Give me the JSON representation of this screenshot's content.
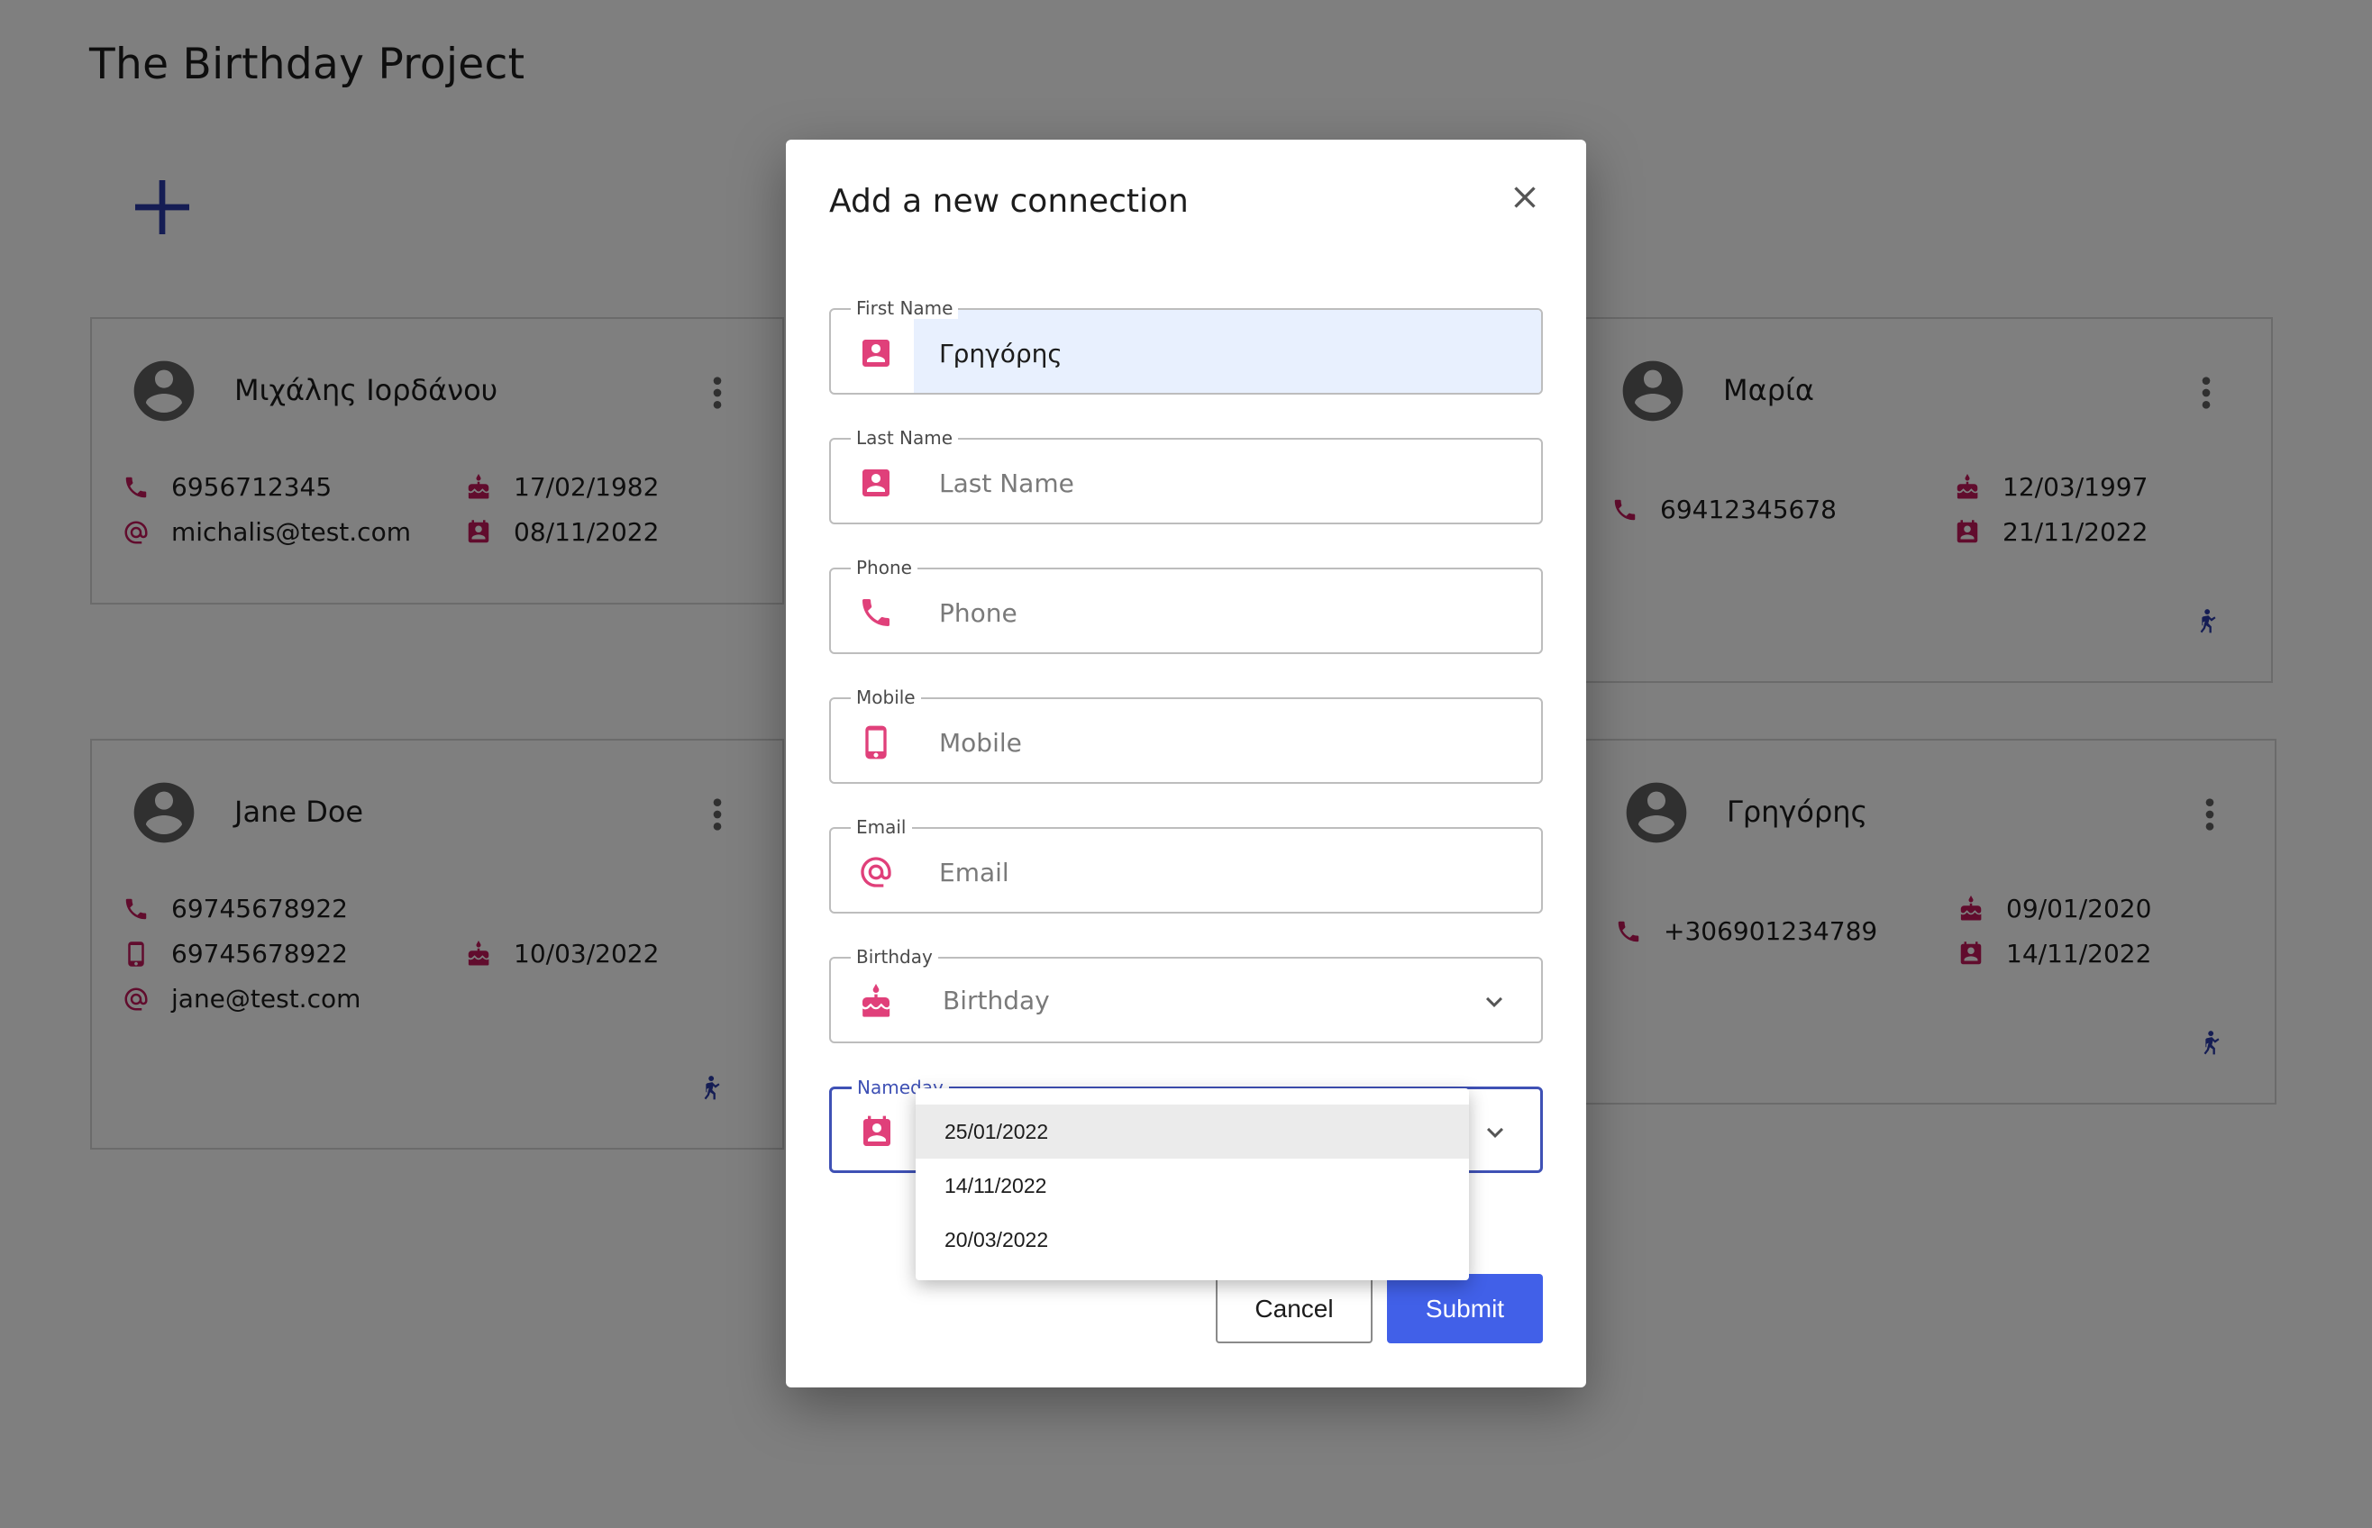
{
  "app": {
    "title": "The Birthday Project"
  },
  "colors": {
    "accent": "#3f51b5",
    "icon_pink": "#e0407a",
    "card_icon": "#c2185b",
    "submit_bg": "#4160e8",
    "overlay": "rgba(0,0,0,0.5)"
  },
  "cards": [
    {
      "name": "Μιχάλης Ιορδάνου",
      "phone": "6956712345",
      "email": "michalis@test.com",
      "birthday": "17/02/1982",
      "nameday": "08/11/2022"
    },
    {
      "name": "Jane Doe",
      "phone": "69745678922",
      "mobile": "69745678922",
      "email": "jane@test.com",
      "birthday": "10/03/2022"
    },
    {
      "name": "Μαρία",
      "phone": "69412345678",
      "birthday": "12/03/1997",
      "nameday": "21/11/2022"
    },
    {
      "name": "Γρηγόρης",
      "phone": "+306901234789",
      "birthday": "09/01/2020",
      "nameday": "14/11/2022"
    }
  ],
  "dialog": {
    "title": "Add a new connection",
    "fields": {
      "first_name": {
        "label": "First Name",
        "value": "Γρηγόρης",
        "placeholder": "First Name"
      },
      "last_name": {
        "label": "Last Name",
        "value": "",
        "placeholder": "Last Name"
      },
      "phone": {
        "label": "Phone",
        "value": "",
        "placeholder": "Phone"
      },
      "mobile": {
        "label": "Mobile",
        "value": "",
        "placeholder": "Mobile"
      },
      "email": {
        "label": "Email",
        "value": "",
        "placeholder": "Email"
      },
      "birthday": {
        "label": "Birthday",
        "placeholder": "Birthday"
      },
      "nameday": {
        "label": "Nameday"
      }
    },
    "nameday_options": [
      "25/01/2022",
      "14/11/2022",
      "20/03/2022"
    ],
    "nameday_highlighted": "25/01/2022",
    "cancel_label": "Cancel",
    "submit_label": "Submit"
  }
}
